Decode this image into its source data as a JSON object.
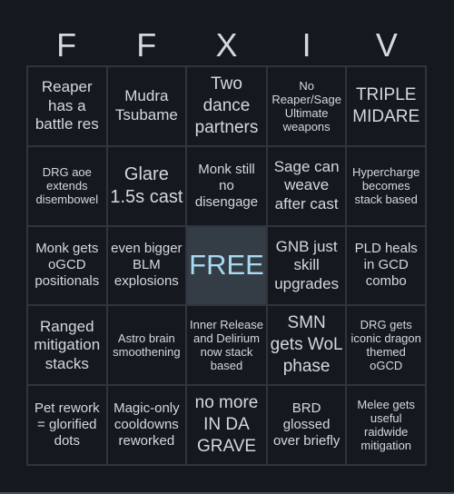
{
  "header": {
    "letters": [
      "F",
      "F",
      "X",
      "I",
      "V"
    ]
  },
  "colors": {
    "background": "#15181f",
    "text": "#d3d9df",
    "border": "#2e353c",
    "free_bg": "#343d46",
    "free_text": "#a8daf2"
  },
  "cells": [
    [
      "Reaper has a battle res",
      "Mudra Tsubame",
      "Two dance partners",
      "No Reaper/Sage Ultimate weapons",
      "TRIPLE MIDARE"
    ],
    [
      "DRG aoe extends disembowel",
      "Glare 1.5s cast",
      "Monk still no disengage",
      "Sage can weave after cast",
      "Hypercharge becomes stack based"
    ],
    [
      "Monk gets oGCD positionals",
      "even bigger BLM explosions",
      "FREE",
      "GNB just skill upgrades",
      "PLD heals in GCD combo"
    ],
    [
      "Ranged mitigation stacks",
      "Astro brain smoothening",
      "Inner Release and Delirium now stack based",
      "SMN gets WoL phase",
      "DRG gets iconic dragon themed oGCD"
    ],
    [
      "Pet rework = glorified dots",
      "Magic-only cooldowns reworked",
      "no more IN DA GRAVE",
      "BRD glossed over briefly",
      "Melee gets useful raidwide mitigation"
    ]
  ]
}
